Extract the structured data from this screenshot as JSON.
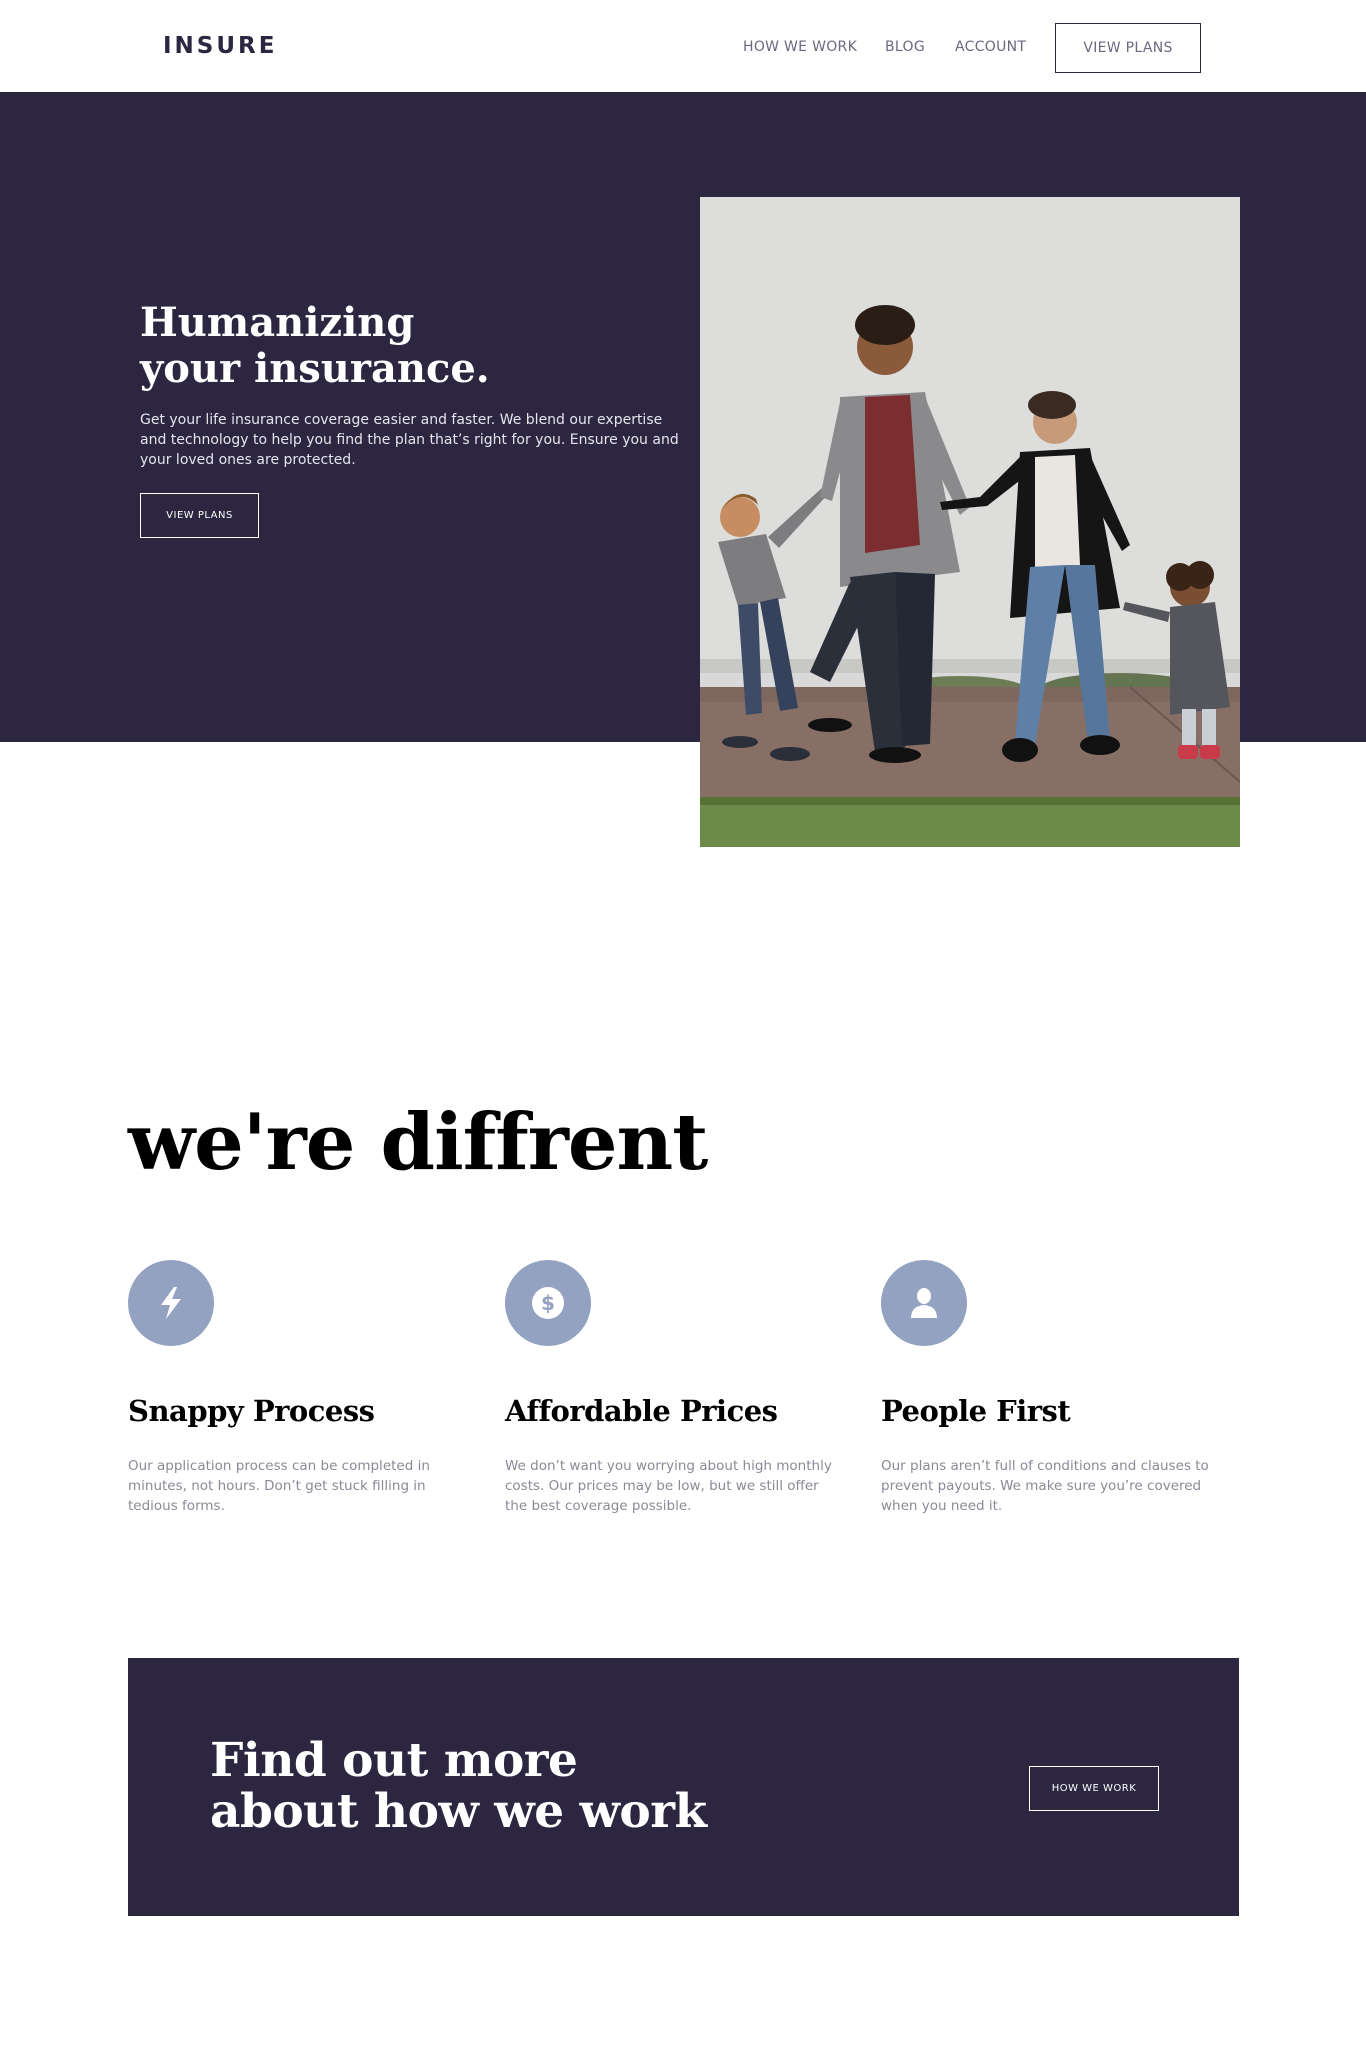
{
  "header": {
    "logo": "INSURE",
    "nav": [
      {
        "label": "HOW WE WORK"
      },
      {
        "label": "BLOG"
      },
      {
        "label": "ACCOUNT"
      }
    ],
    "cta_label": "VIEW PLANS"
  },
  "hero": {
    "title": "Humanizing\nyour insurance.",
    "text": "Get your life insurance coverage easier and faster. We blend our expertise and technology to help you find the plan that’s right for you. Ensure you and your loved ones are protected.",
    "button_label": "VIEW PLANS"
  },
  "features_section": {
    "title": "we're diffrent",
    "features": [
      {
        "icon": "lightning-icon",
        "title": "Snappy Process",
        "text": "Our application process can be completed in minutes, not hours. Don’t get stuck filling in tedious forms."
      },
      {
        "icon": "dollar-icon",
        "title": "Affordable Prices",
        "text": "We don’t want you worrying about high monthly costs. Our prices may be low, but we still offer the best coverage possible."
      },
      {
        "icon": "person-icon",
        "title": "People First",
        "text": "Our plans aren’t full of conditions and clauses to prevent payouts. We make sure you’re covered when you need it."
      }
    ]
  },
  "cta": {
    "title": "Find out more\nabout how we work",
    "button_label": "HOW WE WORK"
  },
  "colors": {
    "dark_violet": "#2c2640",
    "icon_bg": "#93a2c1",
    "muted_text": "#8a8a96"
  }
}
